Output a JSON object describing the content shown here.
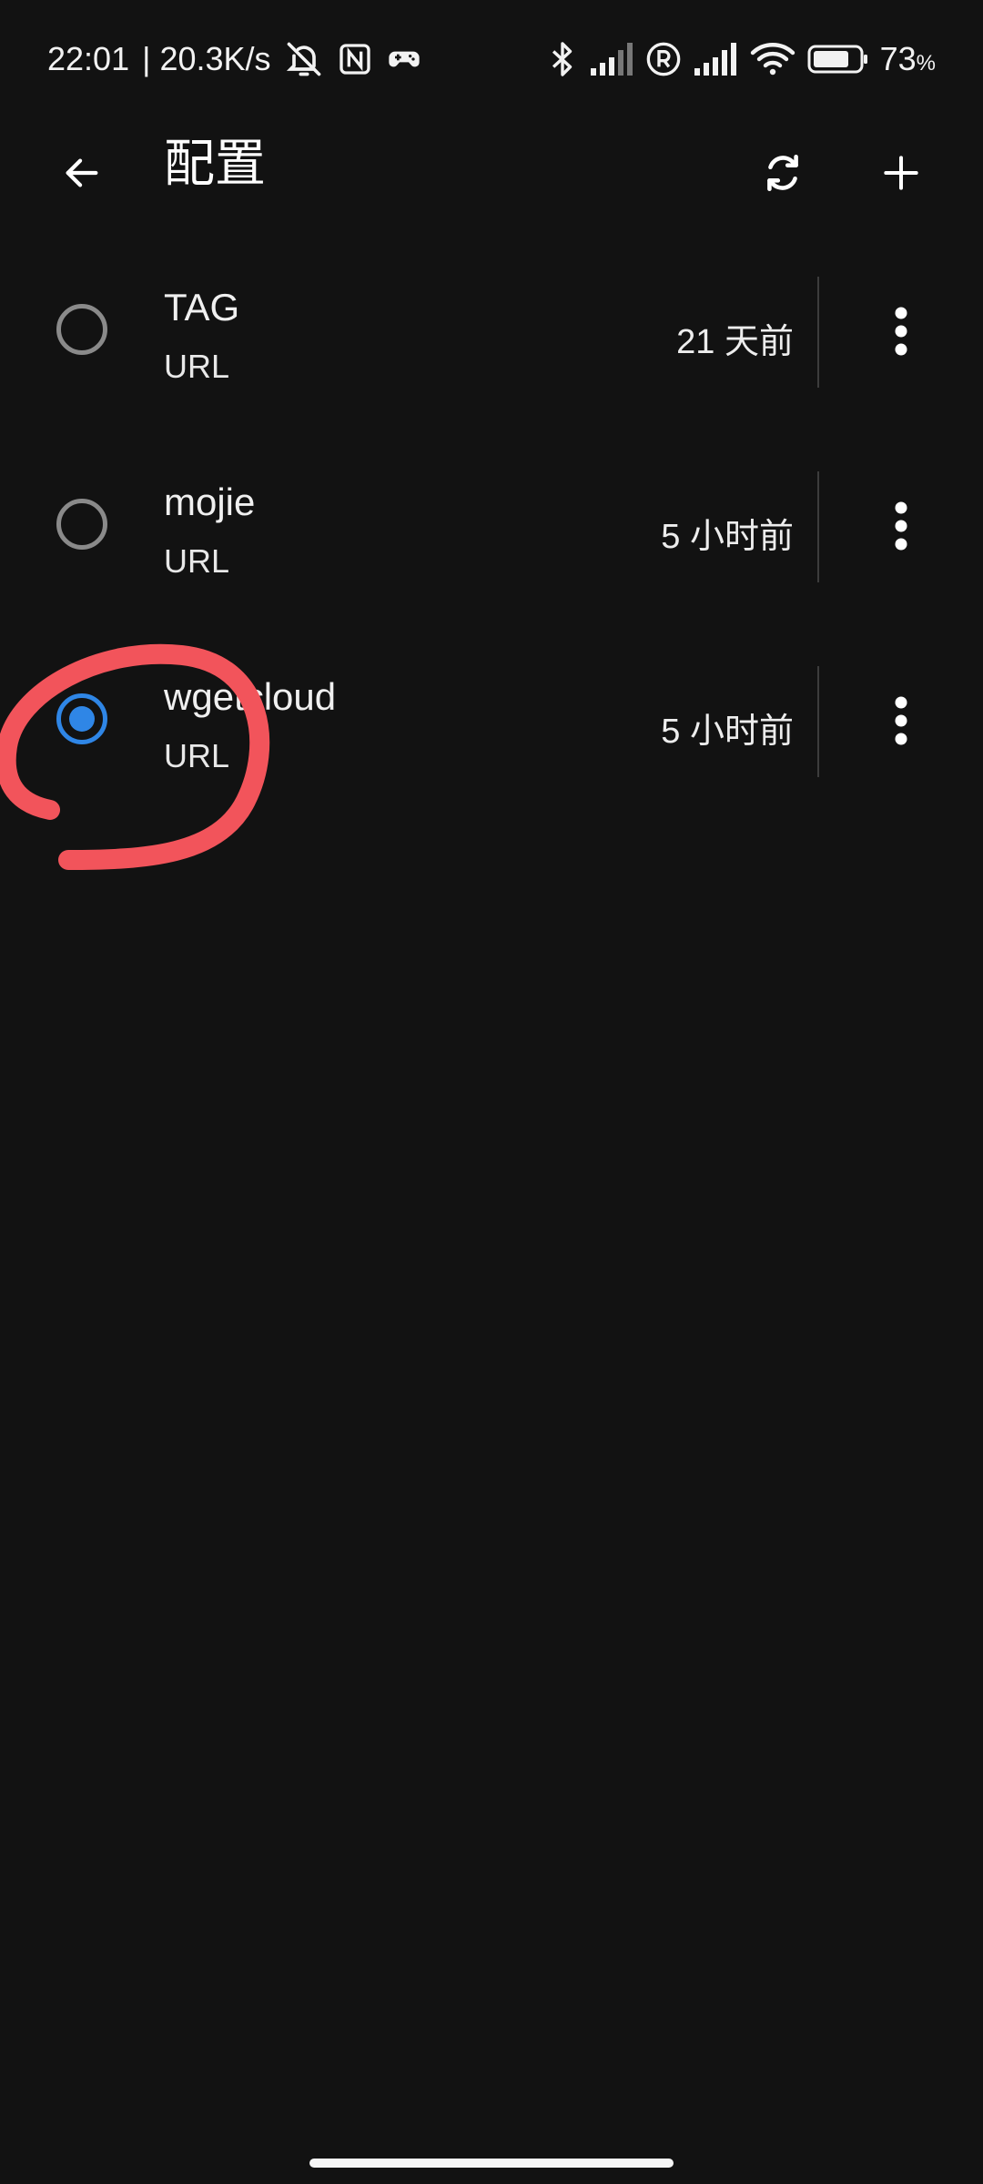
{
  "status_bar": {
    "time": "22:01",
    "net_speed": "| 20.3K/s",
    "battery": "73",
    "battery_unit": "%"
  },
  "app_bar": {
    "title": "配置"
  },
  "profiles": [
    {
      "name": "TAG",
      "type": "URL",
      "updated": "21 天前",
      "selected": false
    },
    {
      "name": "mojie",
      "type": "URL",
      "updated": "5 小时前",
      "selected": false
    },
    {
      "name": "wgetcloud",
      "type": "URL",
      "updated": "5 小时前",
      "selected": true
    }
  ],
  "colors": {
    "background": "#121212",
    "accent": "#2f86e6",
    "annotation": "#f2545b",
    "radio_unselected": "#8a8a8a"
  },
  "icons": {
    "back": "arrow-left-icon",
    "refresh": "refresh-icon",
    "add": "plus-icon",
    "more": "more-vertical-icon"
  }
}
